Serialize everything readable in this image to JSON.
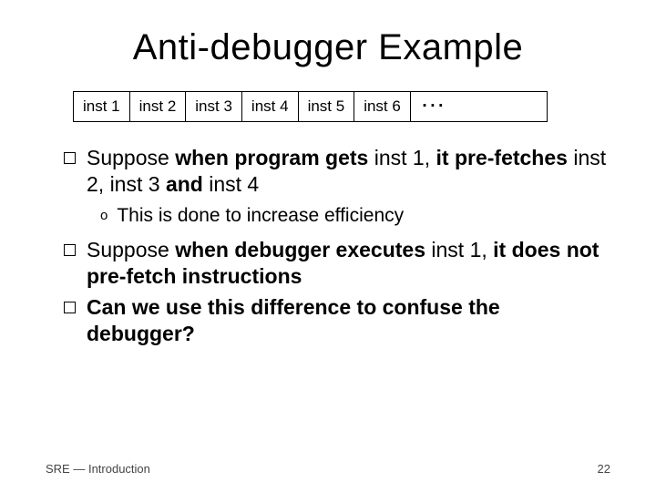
{
  "title": "Anti-debugger Example",
  "instructions": [
    "inst 1",
    "inst 2",
    "inst 3",
    "inst 4",
    "inst 5",
    "inst 6"
  ],
  "ellipsis": "…",
  "bullets": {
    "b1": {
      "pre1": "Suppose ",
      "b1": "when program gets",
      "mid1": " inst 1, ",
      "b2": "it pre-fetches",
      "mid2": " inst 2, inst 3 ",
      "b3": "and",
      "post": " inst 4"
    },
    "s1": "This is done to increase efficiency",
    "b2": {
      "pre1": "Suppose ",
      "b1": "when debugger executes",
      "mid1": " inst 1, ",
      "b2": "it does ",
      "b3": "not",
      "b4": " pre-fetch instructions"
    },
    "b3": "Can we use this difference to confuse the debugger?"
  },
  "footer": {
    "left_a": "SRE ",
    "dash": "—",
    "left_b": " Introduction",
    "page": "22"
  }
}
